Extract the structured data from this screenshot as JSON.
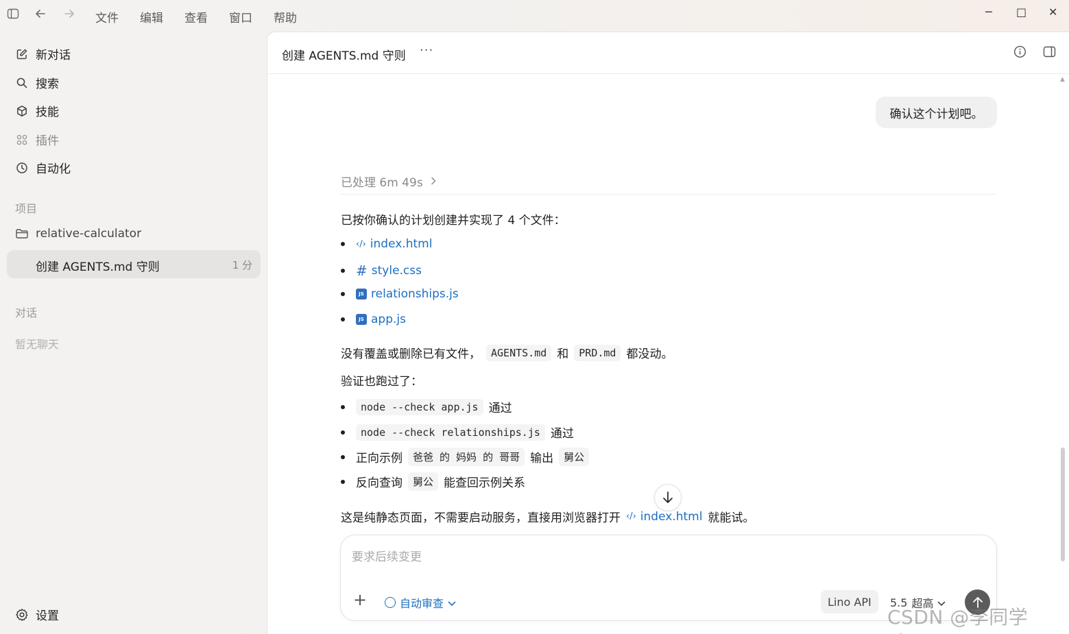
{
  "menu": [
    "文件",
    "编辑",
    "查看",
    "窗口",
    "帮助"
  ],
  "window_controls": {
    "minimize": "─",
    "maximize": "□",
    "close": "✕"
  },
  "sidebar": {
    "nav": [
      {
        "label": "新对话",
        "icon": "edit-icon"
      },
      {
        "label": "搜索",
        "icon": "search-icon"
      },
      {
        "label": "技能",
        "icon": "cube-icon"
      },
      {
        "label": "插件",
        "icon": "grid-icon"
      },
      {
        "label": "自动化",
        "icon": "clock-icon"
      }
    ],
    "projects_label": "项目",
    "project_name": "relative-calculator",
    "active_chat": {
      "title": "创建 AGENTS.md 守则",
      "time": "1 分"
    },
    "chats_label": "对话",
    "no_chats": "暂无聊天",
    "settings_label": "设置"
  },
  "header": {
    "title": "创建 AGENTS.md 守则",
    "more": "···"
  },
  "conversation": {
    "user_message": "确认这个计划吧。",
    "processed": "已处理 6m 49s",
    "intro": "已按你确认的计划创建并实现了 4 个文件：",
    "files": [
      {
        "name": "index.html",
        "icon": "code-icon"
      },
      {
        "name": "style.css",
        "icon": "hash-icon"
      },
      {
        "name": "relationships.js",
        "icon": "js-file-icon"
      },
      {
        "name": "app.js",
        "icon": "js-file-icon"
      }
    ],
    "no_overwrite": {
      "prefix": "没有覆盖或删除已有文件，",
      "code1": "AGENTS.md",
      "and": "和",
      "code2": "PRD.md",
      "suffix": "都没动。"
    },
    "verified": "验证也跑过了：",
    "checks": [
      {
        "code": "node --check app.js",
        "text": "通过"
      },
      {
        "code": "node --check relationships.js",
        "text": "通过"
      }
    ],
    "example_forward": {
      "label": "正向示例",
      "code": "爸爸 的 妈妈 的 哥哥",
      "mid": "输出",
      "result": "舅公"
    },
    "example_reverse": {
      "label": "反向查询",
      "code": "舅公",
      "text": "能查回示例关系"
    },
    "closing": {
      "prefix": "这是纯静态页面，不需要启动服务，直接用浏览器打开",
      "link": "index.html",
      "suffix": "就能试。"
    }
  },
  "composer": {
    "placeholder": "要求后续变更",
    "review_label": "自动审查",
    "api_label": "Lino API",
    "model_version": "5.5",
    "model_mode": "超高"
  },
  "watermark": "CSDN @李同学Lino"
}
